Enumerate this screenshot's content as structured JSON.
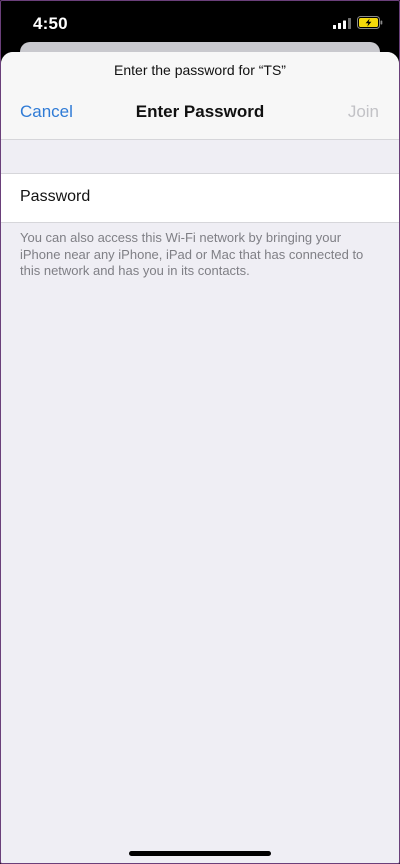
{
  "status_bar": {
    "time": "4:50"
  },
  "sheet": {
    "prompt": "Enter the password for “TS”",
    "title": "Enter Password",
    "cancel_label": "Cancel",
    "join_label": "Join"
  },
  "password_row": {
    "label": "Password",
    "value": ""
  },
  "footnote": "You can also access this Wi-Fi network by bringing your iPhone near any iPhone, iPad or Mac that has connected to this network and has you in its contacts.",
  "colors": {
    "accent": "#2f7bd6",
    "disabled": "#c2c2c6",
    "background": "#efeef4",
    "battery_charging": "#f5d90a"
  },
  "icons": {
    "signal": "cellular-signal-icon",
    "battery": "battery-charging-icon"
  }
}
